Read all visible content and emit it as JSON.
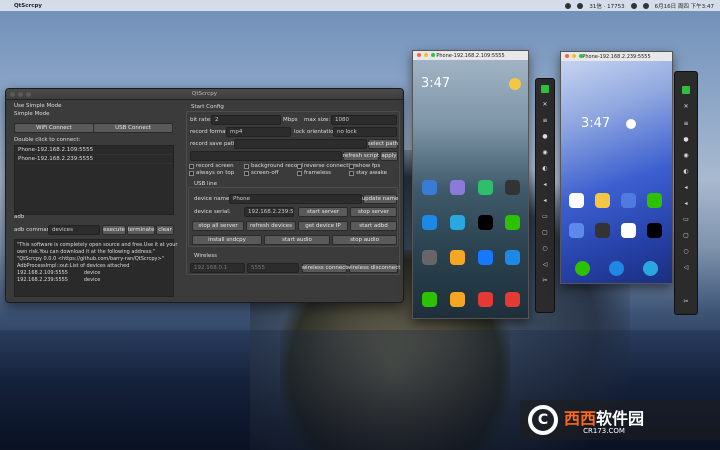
{
  "menubar": {
    "app_name": "QtScrcpy",
    "time": "6月16日 周四 下午3:47",
    "status_text": "31信 · 17753"
  },
  "window": {
    "title": "QtScrcpy"
  },
  "left": {
    "use_simple_mode": "Use Simple Mode",
    "simple_mode": "Simple Mode",
    "wifi_connect": "WiFi Connect",
    "usb_connect": "USB Connect",
    "double_click": "Double click to connect:",
    "devices": [
      "Phone-192.168.2.109:5555",
      "Phone-192.168.2.239:5555"
    ],
    "adb_label": "adb",
    "adb_command_label": "adb command:",
    "adb_command_value": "devices",
    "execute": "execute",
    "terminate": "terminate",
    "clear": "clear",
    "log": [
      "\"This software is completely open source and free.Use it at your",
      "own risk.You can download it at the following address:\"",
      "",
      "\"QtScrcpy 0.0.0 <https://github.com/barry-ran/QtScrcpy>\"",
      "",
      "AdbProcessImpl::out:List of devices attached",
      "192.168.2.109:5555          device",
      "192.168.2.239:5555          device"
    ]
  },
  "right": {
    "start_config": "Start Config",
    "bit_rate_label": "bit rate:",
    "bit_rate_value": "2",
    "mbps": "Mbps",
    "max_size_label": "max size:",
    "max_size_value": "1080",
    "record_format_label": "record format:",
    "record_format_value": "mp4",
    "lock_orientation_label": "lock orientation:",
    "lock_orientation_value": "no lock",
    "record_save_path_label": "record save path:",
    "select_path": "select path",
    "refresh_script": "refresh script",
    "apply": "apply",
    "record_screen": "record screen",
    "background_record": "background record",
    "reverse_connection": "reverse connection",
    "show_fps": "show fps",
    "always_on_top": "always on top",
    "screen_off": "screen-off",
    "frameless": "frameless",
    "stay_awake": "stay awake",
    "usb_line": "USB line",
    "device_name_label": "device name:",
    "device_name_value": "Phone",
    "update_name": "update name",
    "device_serial_label": "device serial:",
    "device_serial_value": "192.168.2.239:5",
    "start_server": "start server",
    "stop_server": "stop server",
    "stop_all_server": "stop all server",
    "refresh_devices": "refresh devices",
    "get_device_ip": "get device IP",
    "start_adbd": "start adbd",
    "install_sndcpy": "install sndcpy",
    "start_audio": "start audio",
    "stop_audio": "stop audio",
    "wireless": "Wireless",
    "wireless_ip": "192.168.0.1",
    "wireless_port": "5555",
    "wireless_connect": "wireless connect",
    "wireless_disconnect": "wireless disconnect"
  },
  "phone1": {
    "title": "Phone-192.168.2.109:5555",
    "time": "3:47"
  },
  "phone2": {
    "title": "Phone-192.168.2.239:5555",
    "time": "3:47"
  },
  "watermark": {
    "logo": "C",
    "t1": "西西",
    "t2": "软件园",
    "sub": "CR173.COM"
  }
}
